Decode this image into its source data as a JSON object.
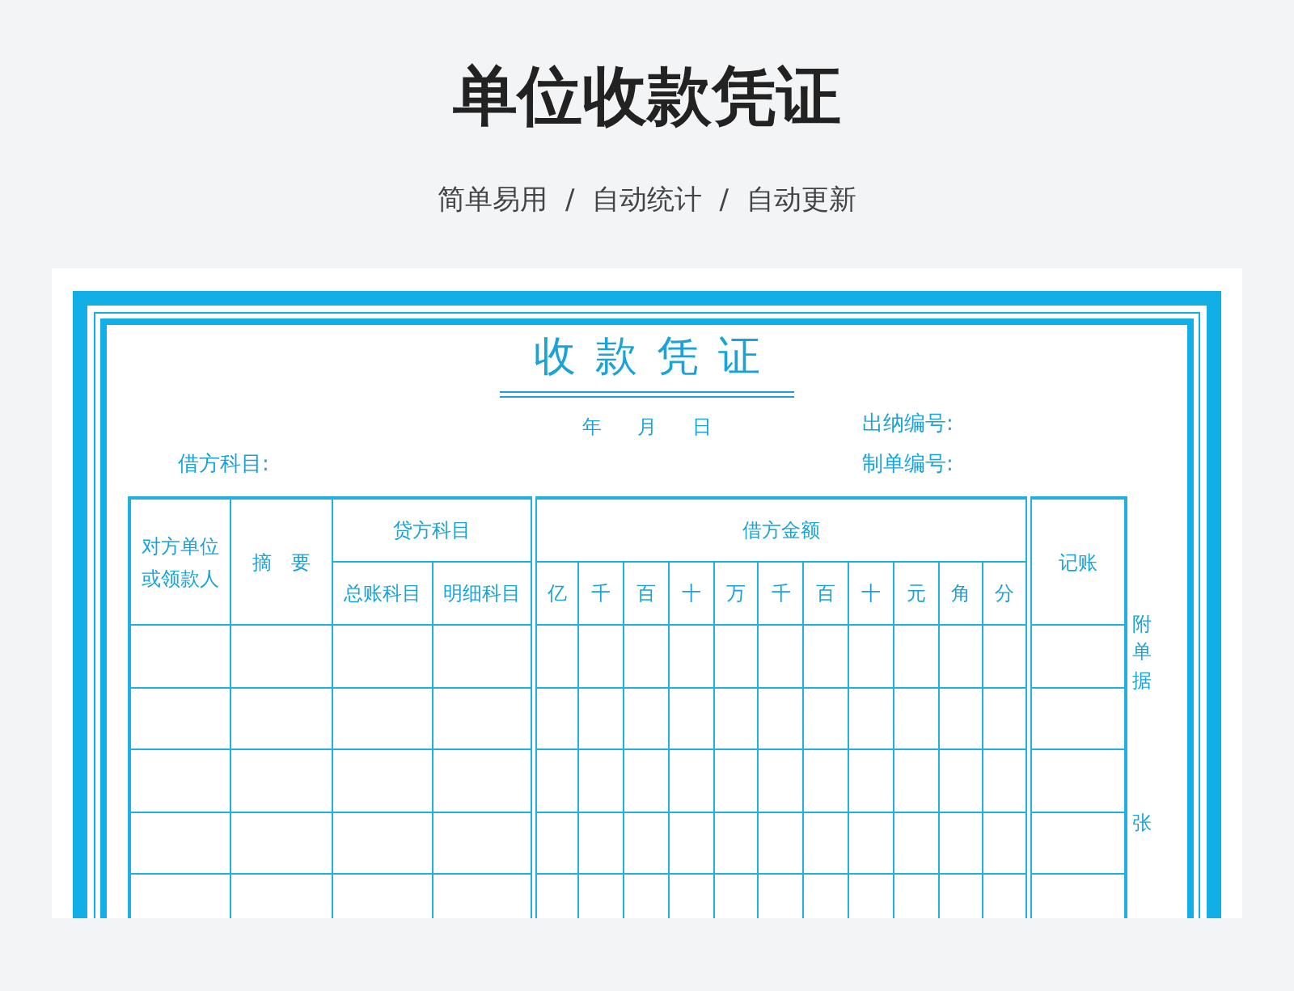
{
  "banner": {
    "title": "单位收款凭证",
    "subtitle": "简单易用  /  自动统计  /  自动更新"
  },
  "voucher": {
    "title": "收款凭证",
    "date_parts": [
      "年",
      "月",
      "日"
    ],
    "debit_account_label": "借方科目:",
    "cashier_number_label": "出纳编号:",
    "voucher_number_label": "制单编号:",
    "columns": [
      {
        "label": "对方单位或领款人"
      },
      {
        "label": "摘　要"
      },
      {
        "label": "贷方科目",
        "children": [
          "总账科目",
          "明细科目"
        ]
      },
      {
        "label": "借方金额",
        "children": [
          "亿",
          "千",
          "百",
          "十",
          "万",
          "千",
          "百",
          "十",
          "元",
          "角",
          "分"
        ]
      },
      {
        "label": "记账"
      }
    ],
    "attachment_labels": [
      "附单据",
      "张"
    ]
  }
}
